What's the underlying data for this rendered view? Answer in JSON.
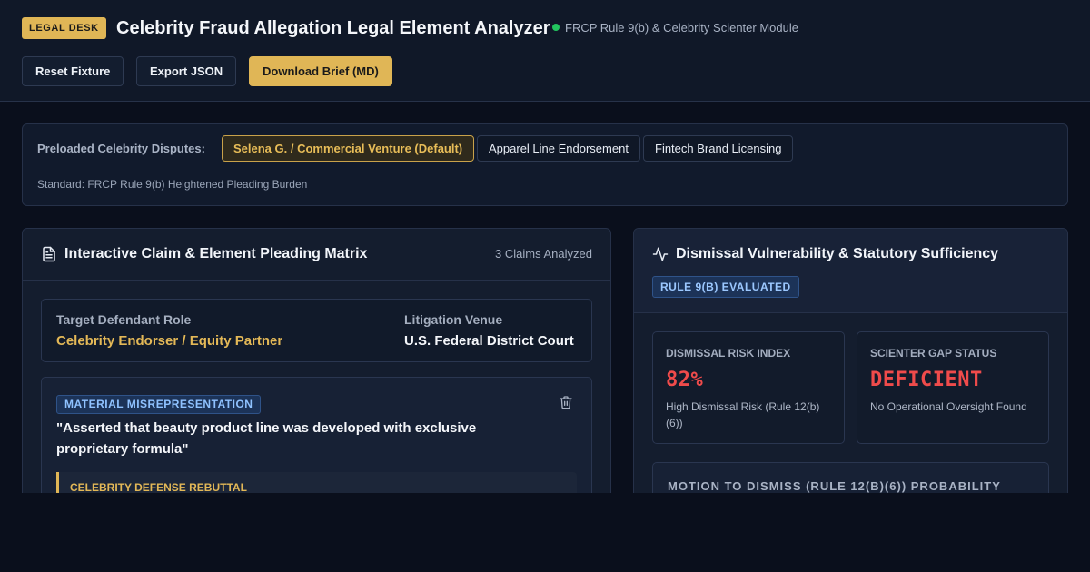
{
  "header": {
    "badge": "LEGAL DESK",
    "title": "Celebrity Fraud Allegation Legal Element Analyzer",
    "module_status": "FRCP Rule 9(b) & Celebrity Scienter Module",
    "buttons": {
      "reset": "Reset Fixture",
      "export": "Export JSON",
      "download": "Download Brief (MD)"
    }
  },
  "presets": {
    "label": "Preloaded Celebrity Disputes:",
    "items": [
      {
        "label": "Selena G. / Commercial Venture (Default)",
        "active": true
      },
      {
        "label": "Apparel Line Endorsement",
        "active": false
      },
      {
        "label": "Fintech Brand Licensing",
        "active": false
      }
    ],
    "standard": "Standard: FRCP Rule 9(b) Heightened Pleading Burden"
  },
  "matrix": {
    "title": "Interactive Claim & Element Pleading Matrix",
    "count": "3 Claims Analyzed",
    "defendant_role_label": "Target Defendant Role",
    "defendant_role_value": "Celebrity Endorser / Equity Partner",
    "venue_label": "Litigation Venue",
    "venue_value": "U.S. Federal District Court",
    "claim": {
      "tag": "MATERIAL MISREPRESENTATION",
      "text": "\"Asserted that beauty product line was developed with exclusive proprietary formula\"",
      "rebuttal_label": "CELEBRITY DEFENSE REBUTTAL"
    }
  },
  "vulnerability": {
    "title": "Dismissal Vulnerability & Statutory Sufficiency",
    "badge": "RULE 9(B) EVALUATED",
    "risk_label": "DISMISSAL RISK INDEX",
    "risk_value": "82%",
    "risk_sub": "High Dismissal Risk (Rule 12(b)(6))",
    "scienter_label": "SCIENTER GAP STATUS",
    "scienter_value": "DEFICIENT",
    "scienter_sub": "No Operational Oversight Found",
    "probability_title": "MOTION TO DISMISS (RULE 12(B)(6)) PROBABILITY"
  },
  "colors": {
    "accent": "#e0b656",
    "danger": "#ef4b4b",
    "status_ok": "#22c55e",
    "info": "#8fc2ff"
  }
}
